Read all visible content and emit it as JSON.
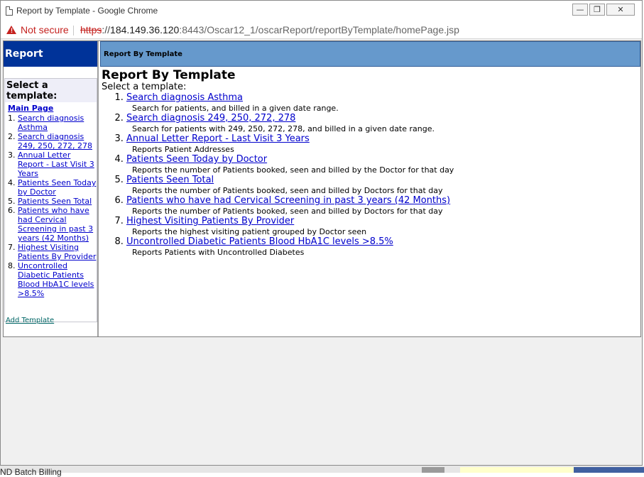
{
  "window": {
    "title": "Report by Template - Google Chrome"
  },
  "address_bar": {
    "security_label": "Not secure",
    "url_scheme": "https",
    "url_sep": "://",
    "url_host": "184.149.36.120",
    "url_rest": ":8443/Oscar12_1/oscarReport/reportByTemplate/homePage.jsp"
  },
  "sidebar": {
    "heading": "Report",
    "select_label": "Select a template:",
    "main_page": "Main Page",
    "items": [
      "Search diagnosis Asthma",
      "Search diagnosis 249, 250, 272, 278",
      "Annual Letter Report - Last Visit 3 Years",
      "Patients Seen Today by Doctor",
      "Patients Seen Total",
      "Patients who have had Cervical Screening in past 3 years (42 Months)",
      "Highest Visiting Patients By Provider",
      "Uncontrolled Diabetic Patients Blood HbA1C levels >8.5%"
    ],
    "add_template": "Add Template"
  },
  "main": {
    "header": "Report By Template",
    "title": "Report By Template",
    "subtitle": "Select a template:",
    "templates": [
      {
        "name": "Search diagnosis Asthma",
        "desc": "Search for patients, and billed in a given date range."
      },
      {
        "name": "Search diagnosis 249, 250, 272, 278",
        "desc": "Search for patients with 249, 250, 272, 278, and billed in a given date range."
      },
      {
        "name": "Annual Letter Report - Last Visit 3 Years",
        "desc": "Reports Patient Addresses"
      },
      {
        "name": "Patients Seen Today by Doctor",
        "desc": "Reports the number of Patients booked, seen and billed by the Doctor for that day"
      },
      {
        "name": "Patients Seen Total",
        "desc": "Reports the number of Patients booked, seen and billed by Doctors for that day"
      },
      {
        "name": "Patients who have had Cervical Screening in past 3 years (42 Months)",
        "desc": "Reports the number of Patients booked, seen and billed by Doctors for that day"
      },
      {
        "name": "Highest Visiting Patients By Provider",
        "desc": "Reports the highest visiting patient grouped by Doctor seen"
      },
      {
        "name": "Uncontrolled Diabetic Patients Blood HbA1C levels >8.5%",
        "desc": "Reports Patients with Uncontrolled Diabetes"
      }
    ]
  },
  "background": {
    "partial_text": "ND Batch Billing"
  },
  "colors": {
    "sidebar_header": "#003399",
    "main_header": "#6699cc",
    "link": "#0000cc",
    "warning": "#c5221f"
  }
}
